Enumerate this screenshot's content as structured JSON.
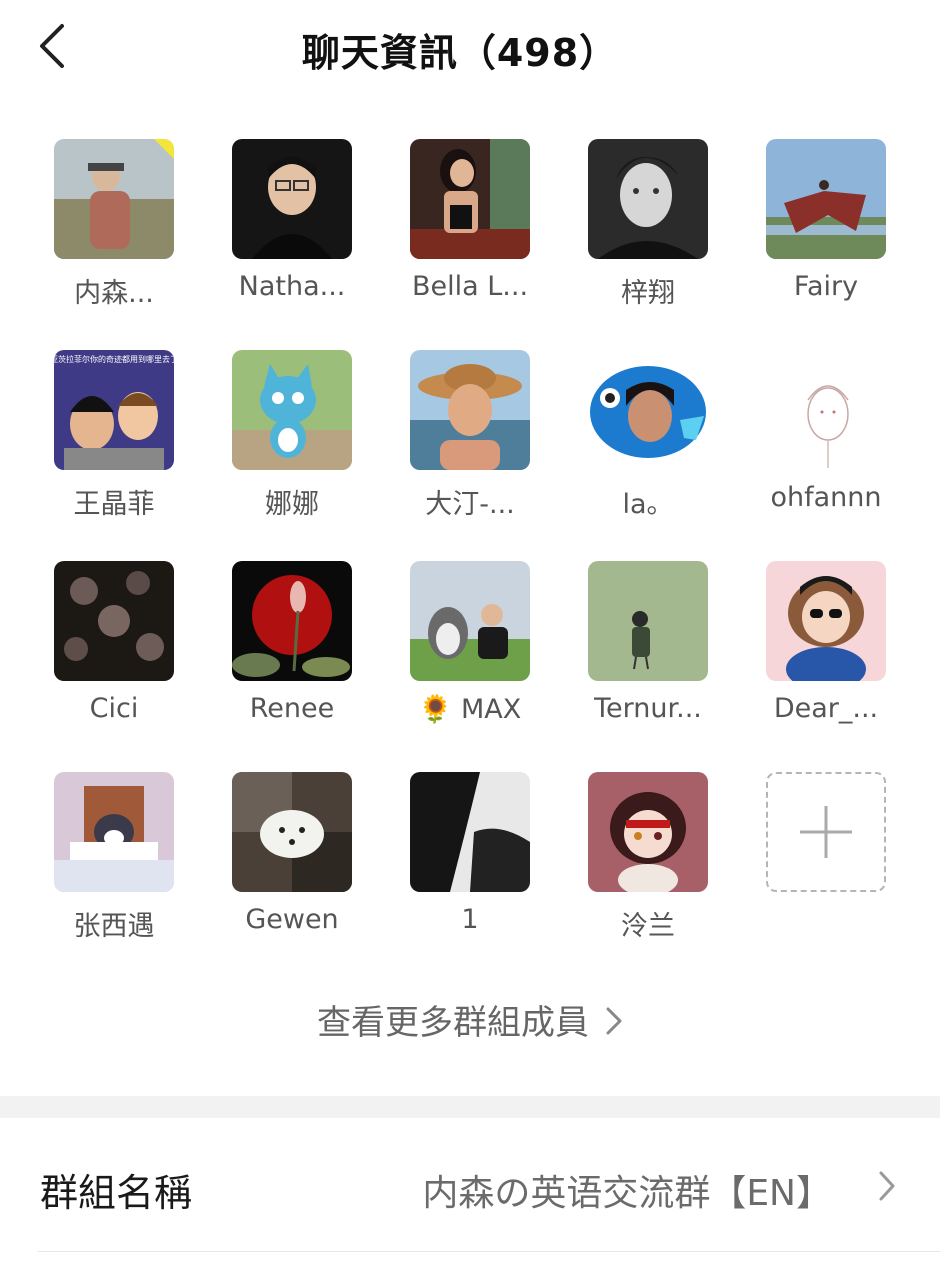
{
  "header": {
    "title": "聊天資訊（498）"
  },
  "members": [
    {
      "name": "内森..."
    },
    {
      "name": "Natha..."
    },
    {
      "name": "Bella L..."
    },
    {
      "name": "梓翔"
    },
    {
      "name": "Fairy"
    },
    {
      "name": "王晶菲",
      "avatar_text": "亚茨拉菲尔你的奇迹都用到哪里去了"
    },
    {
      "name": "娜娜"
    },
    {
      "name": "大汀-..."
    },
    {
      "name": "la。"
    },
    {
      "name": "ohfannn"
    },
    {
      "name": "Cici"
    },
    {
      "name": "Renee"
    },
    {
      "name": "🌻 MAX"
    },
    {
      "name": "Ternur..."
    },
    {
      "name": "Dear_..."
    },
    {
      "name": "张西遇"
    },
    {
      "name": "Gewen"
    },
    {
      "name": "1"
    },
    {
      "name": "泠兰"
    }
  ],
  "see_more": {
    "label": "查看更多群組成員"
  },
  "group_name_row": {
    "label": "群組名稱",
    "value": "内森の英语交流群【EN】"
  }
}
